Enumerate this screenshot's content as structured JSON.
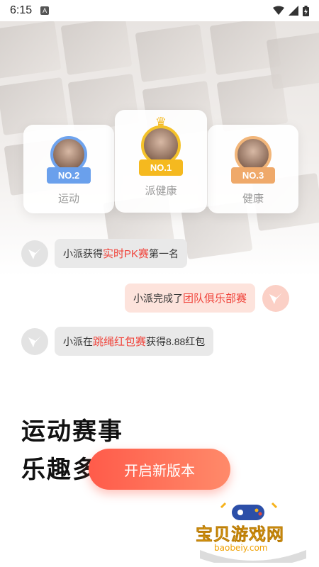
{
  "status_bar": {
    "time": "6:15",
    "badge": "A"
  },
  "ranking": [
    {
      "rank": "NO.2",
      "label": "运动",
      "frame_color": "#6ea3ee",
      "ribbon_color": "#6aa0ec"
    },
    {
      "rank": "NO.1",
      "label": "派健康",
      "frame_color": "#f4c22a",
      "ribbon_color": "#f5b91f"
    },
    {
      "rank": "NO.3",
      "label": "健康",
      "frame_color": "#f2b67a",
      "ribbon_color": "#efa96a"
    }
  ],
  "messages": [
    {
      "prefix": "小派获得",
      "highlight": "实时PK赛",
      "suffix": "第一名",
      "side": "left"
    },
    {
      "prefix": "小派完成了",
      "highlight": "团队俱乐部赛",
      "suffix": "",
      "side": "right"
    },
    {
      "prefix": "小派在",
      "highlight": "跳绳红包赛",
      "suffix": "获得8.88红包",
      "side": "left"
    }
  ],
  "slogan": {
    "line1": "运动赛事",
    "line2": "乐趣多"
  },
  "cta_label": "开启新版本",
  "watermark": {
    "title": "宝贝游戏网",
    "url": "baobeiy.com"
  },
  "colors": {
    "accent": "#ff5b4a",
    "highlight": "#f0433a"
  }
}
